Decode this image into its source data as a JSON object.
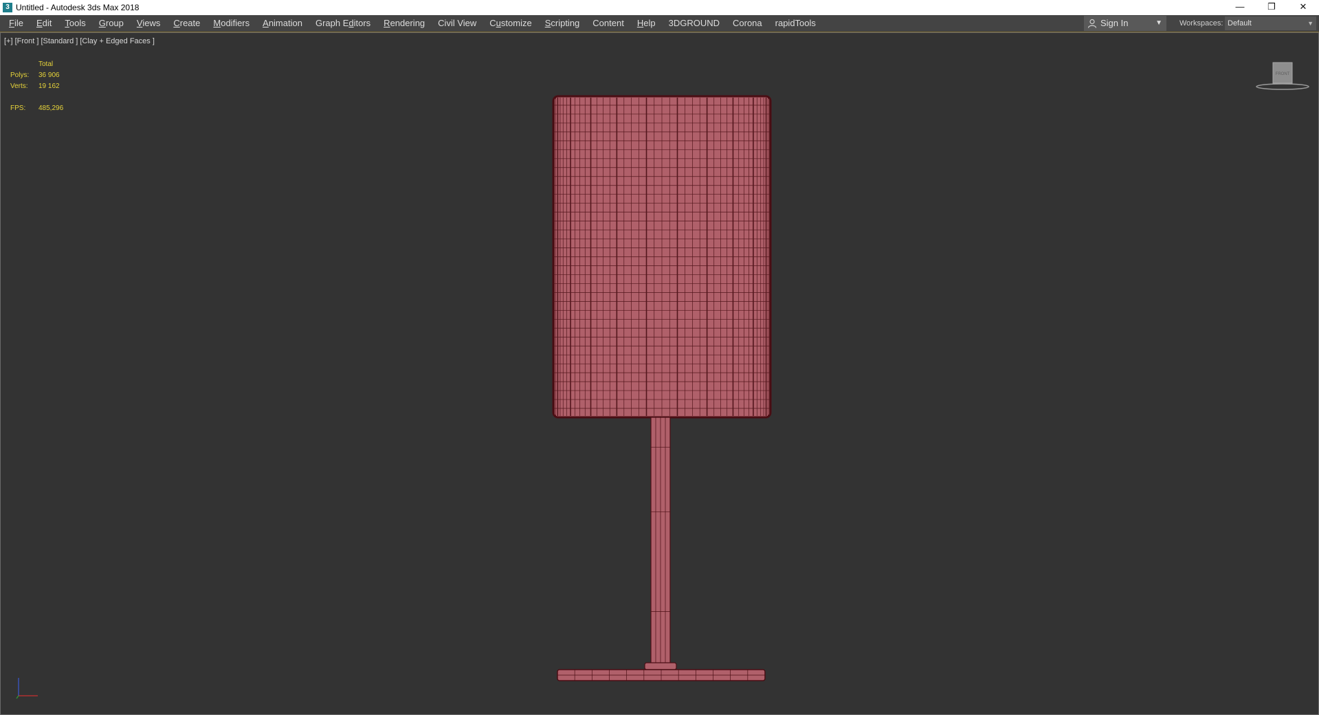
{
  "window": {
    "icon_glyph": "3",
    "title": "Untitled - Autodesk 3ds Max 2018",
    "controls": {
      "minimize": "—",
      "restore": "❐",
      "close": "✕"
    }
  },
  "menu": {
    "items": [
      {
        "pre": "",
        "u": "F",
        "post": "ile"
      },
      {
        "pre": "",
        "u": "E",
        "post": "dit"
      },
      {
        "pre": "",
        "u": "T",
        "post": "ools"
      },
      {
        "pre": "",
        "u": "G",
        "post": "roup"
      },
      {
        "pre": "",
        "u": "V",
        "post": "iews"
      },
      {
        "pre": "",
        "u": "C",
        "post": "reate"
      },
      {
        "pre": "",
        "u": "M",
        "post": "odifiers"
      },
      {
        "pre": "",
        "u": "A",
        "post": "nimation"
      },
      {
        "pre": "Graph E",
        "u": "d",
        "post": "itors"
      },
      {
        "pre": "",
        "u": "R",
        "post": "endering"
      },
      {
        "pre": "Civil View",
        "u": "",
        "post": ""
      },
      {
        "pre": "C",
        "u": "u",
        "post": "stomize"
      },
      {
        "pre": "",
        "u": "S",
        "post": "cripting"
      },
      {
        "pre": "Content",
        "u": "",
        "post": ""
      },
      {
        "pre": "",
        "u": "H",
        "post": "elp"
      },
      {
        "pre": "3DGROUND",
        "u": "",
        "post": ""
      },
      {
        "pre": "Corona",
        "u": "",
        "post": ""
      },
      {
        "pre": "rapidTools",
        "u": "",
        "post": ""
      }
    ],
    "sign_in": "Sign In",
    "workspaces_label": "Workspaces:",
    "workspaces_value": "Default"
  },
  "viewport": {
    "label": "[+] [Front ] [Standard ] [Clay + Edged Faces ]",
    "stats": {
      "header": "Total",
      "polys_label": "Polys:",
      "polys_value": "36 906",
      "verts_label": "Verts:",
      "verts_value": "19 162",
      "fps_label": "FPS:",
      "fps_value": "485,296"
    },
    "viewcube_label": "FRONT",
    "colors": {
      "background": "#333333",
      "mesh_fill": "#b0606a",
      "mesh_wire": "#4a0e14",
      "stats_text": "#e6d33a"
    }
  }
}
